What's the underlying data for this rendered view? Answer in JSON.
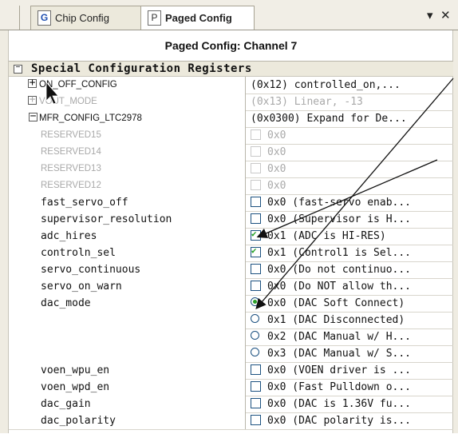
{
  "tabs": [
    {
      "icon_letter": "G",
      "label": "Chip Config"
    },
    {
      "icon_letter": "P",
      "label": "Paged Config"
    }
  ],
  "controls": {
    "dropdown_icon": "chevron-down-icon",
    "dropdown_glyph": "▾",
    "close_icon": "close-icon",
    "close_glyph": "✕"
  },
  "header": {
    "title": "Paged Config: Channel 7"
  },
  "section": {
    "toggle": "−",
    "label": "Special Configuration Registers"
  },
  "rows": [
    {
      "name": "ON_OFF_CONFIG",
      "value": "(0x12)  controlled_on,...",
      "expander": "+"
    },
    {
      "name": "VOUT_MODE",
      "value": "(0x13) Linear, -13",
      "expander": "+",
      "disabled": true
    },
    {
      "name": "MFR_CONFIG_LTC2978",
      "value": "(0x0300) Expand for De...",
      "expander": "−"
    },
    {
      "name": "RESERVED15",
      "value": "0x0",
      "disabled": true
    },
    {
      "name": "RESERVED14",
      "value": "0x0",
      "disabled": true
    },
    {
      "name": "RESERVED13",
      "value": "0x0",
      "disabled": true
    },
    {
      "name": "RESERVED12",
      "value": "0x0",
      "disabled": true
    },
    {
      "name": "fast_servo_off",
      "value": "0x0 (fast-servo enab...",
      "checked": false
    },
    {
      "name": "supervisor_resolution",
      "value": "0x0 (Supervisor is H...",
      "checked": false
    },
    {
      "name": "adc_hires",
      "value": "0x1 (ADC is HI-RES)",
      "checked": true
    },
    {
      "name": "controln_sel",
      "value": "0x1 (Control1 is Sel...",
      "checked": true
    },
    {
      "name": "servo_continuous",
      "value": "0x0 (Do not continuo...",
      "checked": false
    },
    {
      "name": "servo_on_warn",
      "value": "0x0 (Do NOT allow th...",
      "checked": false
    },
    {
      "name": "dac_mode",
      "value": "0x0 (DAC Soft Connect)",
      "radio_selected": true
    },
    {
      "name": "",
      "value": "0x1 (DAC Disconnected)",
      "radio_selected": false
    },
    {
      "name": "",
      "value": "0x2 (DAC Manual w/ H...",
      "radio_selected": false
    },
    {
      "name": "",
      "value": "0x3 (DAC Manual w/ S...",
      "radio_selected": false
    },
    {
      "name": "voen_wpu_en",
      "value": "0x0 (VOEN driver is ...",
      "checked": false
    },
    {
      "name": "voen_wpd_en",
      "value": "0x0 (Fast Pulldown o...",
      "checked": false
    },
    {
      "name": "dac_gain",
      "value": "0x0 (DAC is 1.36V fu...",
      "checked": false
    },
    {
      "name": "dac_polarity",
      "value": "0x0 (DAC polarity is...",
      "checked": false
    }
  ],
  "colors": {
    "check_green": "#21a121",
    "tab_bg": "#ece9dc",
    "grid_line": "#b8b5aa"
  }
}
